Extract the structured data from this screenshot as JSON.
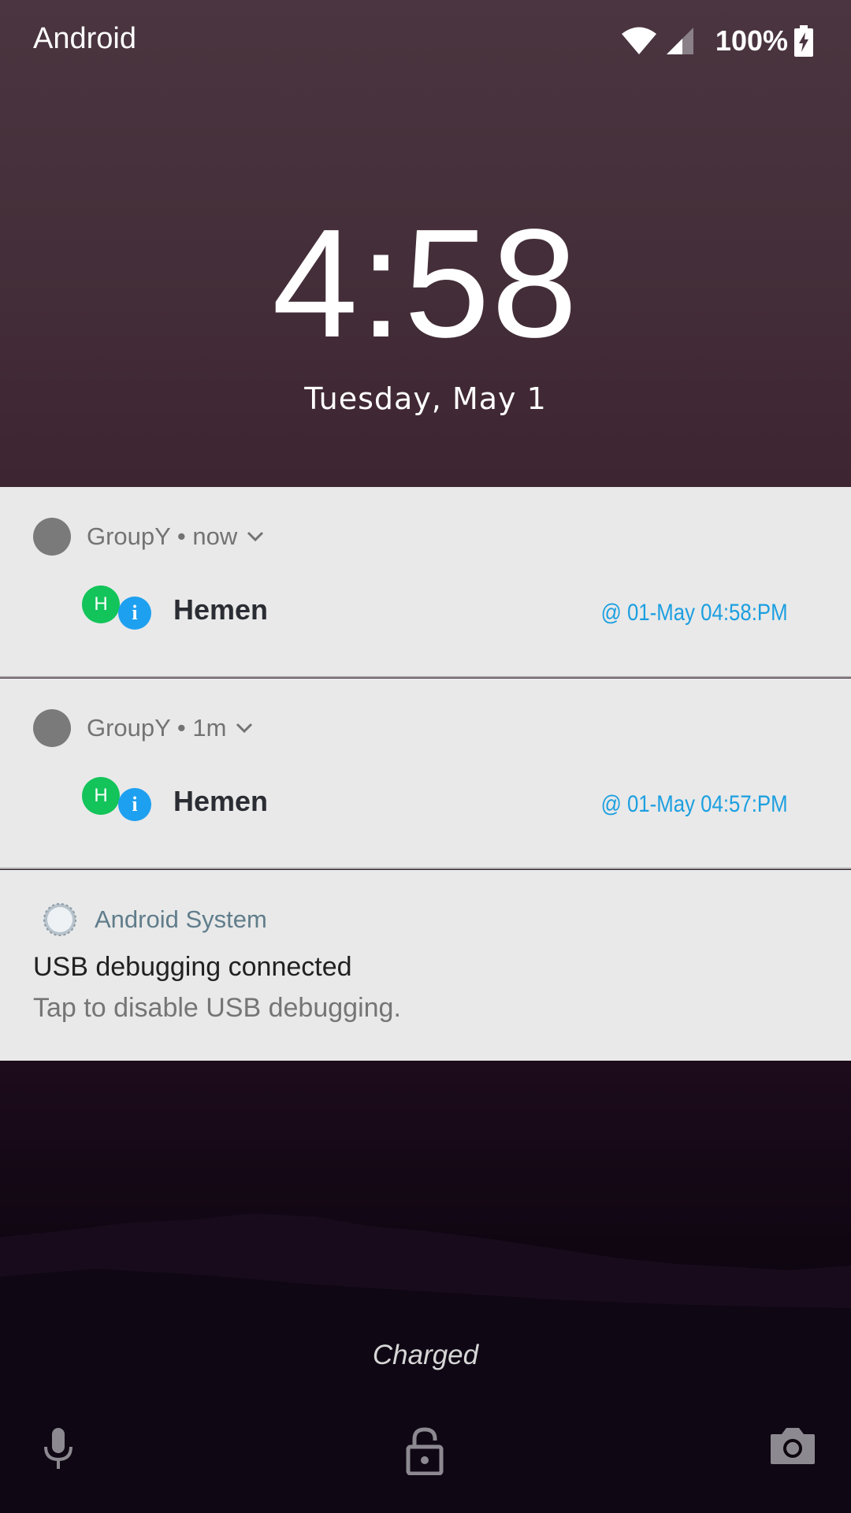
{
  "status_bar": {
    "carrier": "Android",
    "battery_percent": "100%",
    "icons": [
      "wifi-icon",
      "cell-signal-icon",
      "battery-charging-icon"
    ]
  },
  "lockscreen": {
    "time": "4:58",
    "date": "Tuesday, May 1"
  },
  "notifications": [
    {
      "app": "GroupY",
      "age": "now",
      "header": "GroupY • now",
      "avatar_letter": "H",
      "badge": "i",
      "sender": "Hemen",
      "timestamp": "@ 01-May 04:58:PM"
    },
    {
      "app": "GroupY",
      "age": "1m",
      "header": "GroupY • 1m",
      "avatar_letter": "H",
      "badge": "i",
      "sender": "Hemen",
      "timestamp": "@ 01-May 04:57:PM"
    }
  ],
  "system_notification": {
    "app": "Android System",
    "title": "USB debugging connected",
    "text": "Tap to disable USB debugging."
  },
  "charging_status": "Charged",
  "bottom_shortcuts": [
    "mic-icon",
    "unlock-icon",
    "camera-icon"
  ],
  "colors": {
    "notification_bg": "#e9e9e9",
    "timestamp_blue": "#1c9fe0",
    "avatar_green": "#12c45a",
    "badge_blue": "#1ea0f0"
  }
}
